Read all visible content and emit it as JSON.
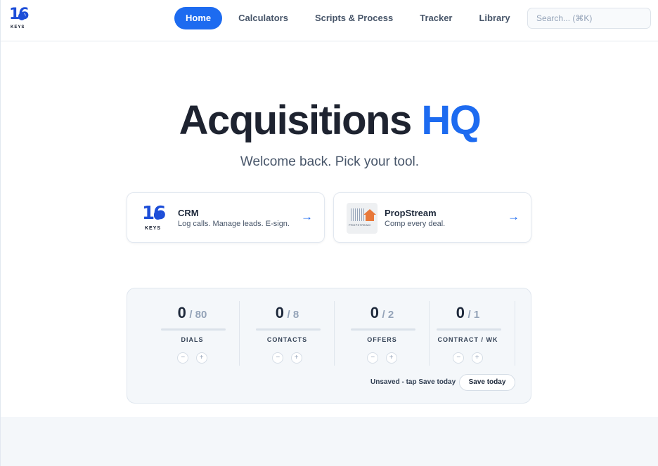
{
  "header": {
    "logo_number": "16",
    "logo_text": "KEYS",
    "nav": [
      "Home",
      "Calculators",
      "Scripts & Process",
      "Tracker",
      "Library"
    ],
    "active_nav": "Home",
    "search_placeholder": "Search... (⌘K)"
  },
  "hero": {
    "title_main": "Acquisitions",
    "title_accent": "HQ",
    "subtitle": "Welcome back. Pick your tool."
  },
  "cards": [
    {
      "title": "CRM",
      "description": "Log calls. Manage leads. E-sign.",
      "arrow": "→",
      "icon": "16-keys-logo"
    },
    {
      "title": "PropStream",
      "description": "Comp every deal.",
      "arrow": "→",
      "icon": "propstream-logo",
      "logo_text": "PROPSTREAM"
    }
  ],
  "tracker": {
    "stats": [
      {
        "label": "DIALS",
        "value": "0",
        "goal": "/ 80",
        "minus": "−",
        "plus": "+"
      },
      {
        "label": "CONTACTS",
        "value": "0",
        "goal": "/ 8",
        "minus": "−",
        "plus": "+"
      },
      {
        "label": "OFFERS",
        "value": "0",
        "goal": "/ 2",
        "minus": "−",
        "plus": "+"
      },
      {
        "label": "CONTRACT / WK",
        "value": "0",
        "goal": "/ 1",
        "minus": "−",
        "plus": "+"
      }
    ],
    "status_text": "Unsaved - tap Save today",
    "save_label": "Save today"
  },
  "colors": {
    "accent": "#1d6bf0",
    "text": "#1e2330",
    "muted": "#94a3b8"
  }
}
